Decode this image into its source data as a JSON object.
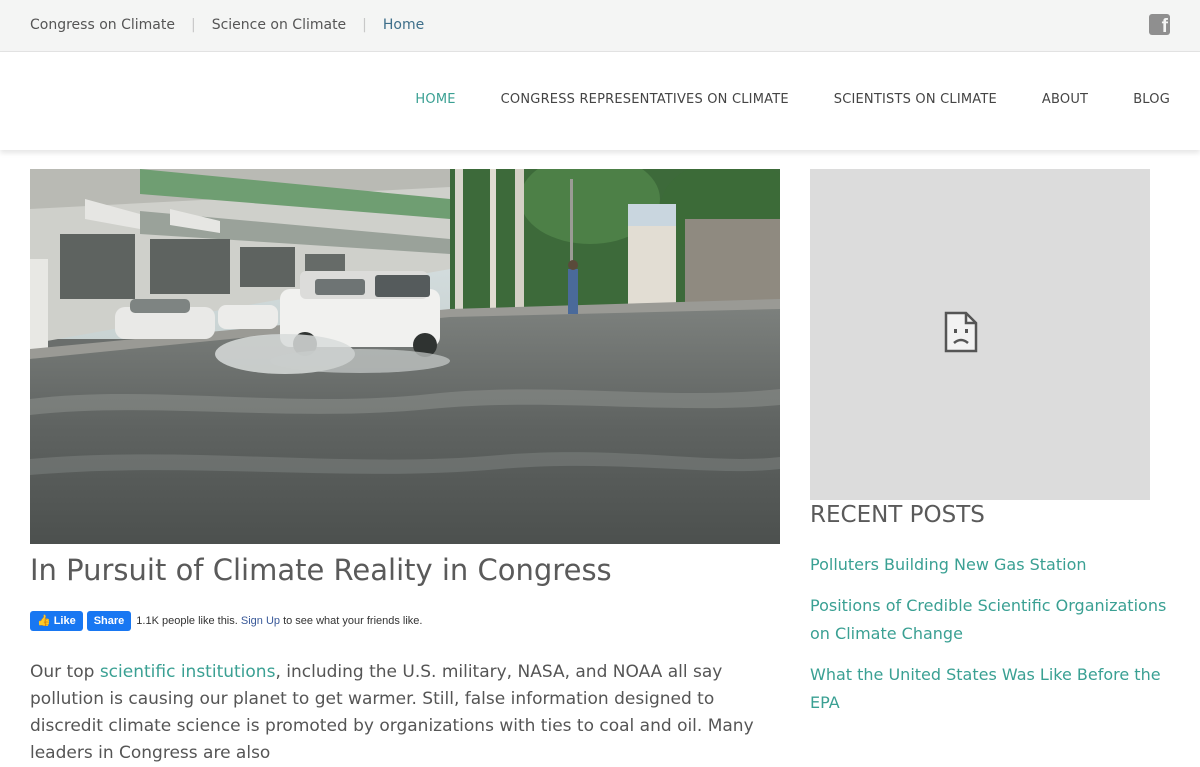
{
  "topbar": {
    "links": [
      {
        "label": "Congress on Climate"
      },
      {
        "label": "Science on Climate"
      },
      {
        "label": "Home"
      }
    ],
    "social_icon": "facebook-icon"
  },
  "nav": {
    "items": [
      {
        "label": "HOME"
      },
      {
        "label": "CONGRESS REPRESENTATIVES ON CLIMATE"
      },
      {
        "label": "SCIENTISTS ON CLIMATE"
      },
      {
        "label": "ABOUT"
      },
      {
        "label": "BLOG"
      }
    ]
  },
  "post": {
    "title": "In Pursuit of Climate Reality in Congress",
    "fb": {
      "like_label": "Like",
      "share_label": "Share",
      "count_text": "1.1K people like this.",
      "signup_label": "Sign Up",
      "signup_suffix": "to see what your friends like."
    },
    "body": {
      "before_link": "Our top ",
      "link_text": "scientific institutions",
      "after_link": ", including the U.S. military, NASA, and NOAA all say pollution is causing our planet to get warmer. Still, false information designed to discredit climate science is promoted by organizations with ties to coal and oil. Many leaders in Congress are also"
    }
  },
  "sidebar": {
    "broken_image_icon": "broken-image-icon",
    "recent_heading": "RECENT POSTS",
    "recent_posts": [
      {
        "label": "Polluters Building New Gas Station"
      },
      {
        "label": "Positions of Credible Scientific Organizations on Climate Change"
      },
      {
        "label": "What the United States Was Like Before the EPA"
      }
    ]
  },
  "colors": {
    "accent": "#3aa093",
    "link_blue": "#3e6f8a",
    "facebook": "#1877f2"
  }
}
